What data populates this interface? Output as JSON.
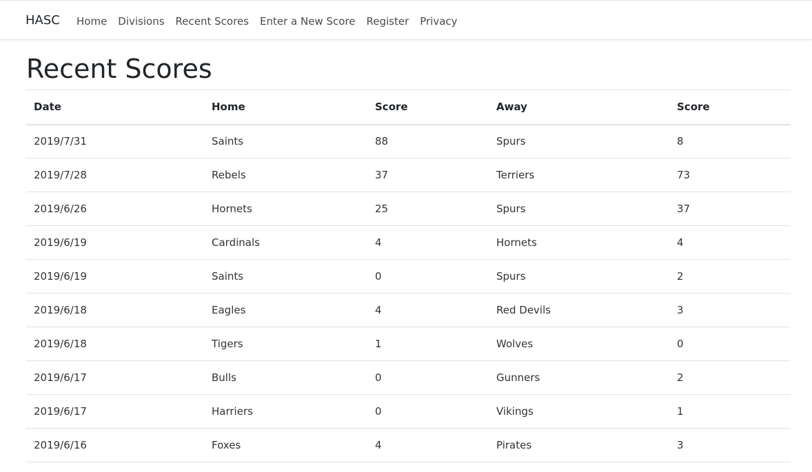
{
  "navbar": {
    "brand": "HASC",
    "links": [
      {
        "label": "Home"
      },
      {
        "label": "Divisions"
      },
      {
        "label": "Recent Scores"
      },
      {
        "label": "Enter a New Score"
      },
      {
        "label": "Register"
      },
      {
        "label": "Privacy"
      }
    ]
  },
  "page": {
    "title": "Recent Scores"
  },
  "table": {
    "headers": [
      "Date",
      "Home",
      "Score",
      "Away",
      "Score"
    ],
    "rows": [
      [
        "2019/7/31",
        "Saints",
        "88",
        "Spurs",
        "8"
      ],
      [
        "2019/7/28",
        "Rebels",
        "37",
        "Terriers",
        "73"
      ],
      [
        "2019/6/26",
        "Hornets",
        "25",
        "Spurs",
        "37"
      ],
      [
        "2019/6/19",
        "Cardinals",
        "4",
        "Hornets",
        "4"
      ],
      [
        "2019/6/19",
        "Saints",
        "0",
        "Spurs",
        "2"
      ],
      [
        "2019/6/18",
        "Eagles",
        "4",
        "Red Devils",
        "3"
      ],
      [
        "2019/6/18",
        "Tigers",
        "1",
        "Wolves",
        "0"
      ],
      [
        "2019/6/17",
        "Bulls",
        "0",
        "Gunners",
        "2"
      ],
      [
        "2019/6/17",
        "Harriers",
        "0",
        "Vikings",
        "1"
      ],
      [
        "2019/6/16",
        "Foxes",
        "4",
        "Pirates",
        "3"
      ]
    ]
  }
}
